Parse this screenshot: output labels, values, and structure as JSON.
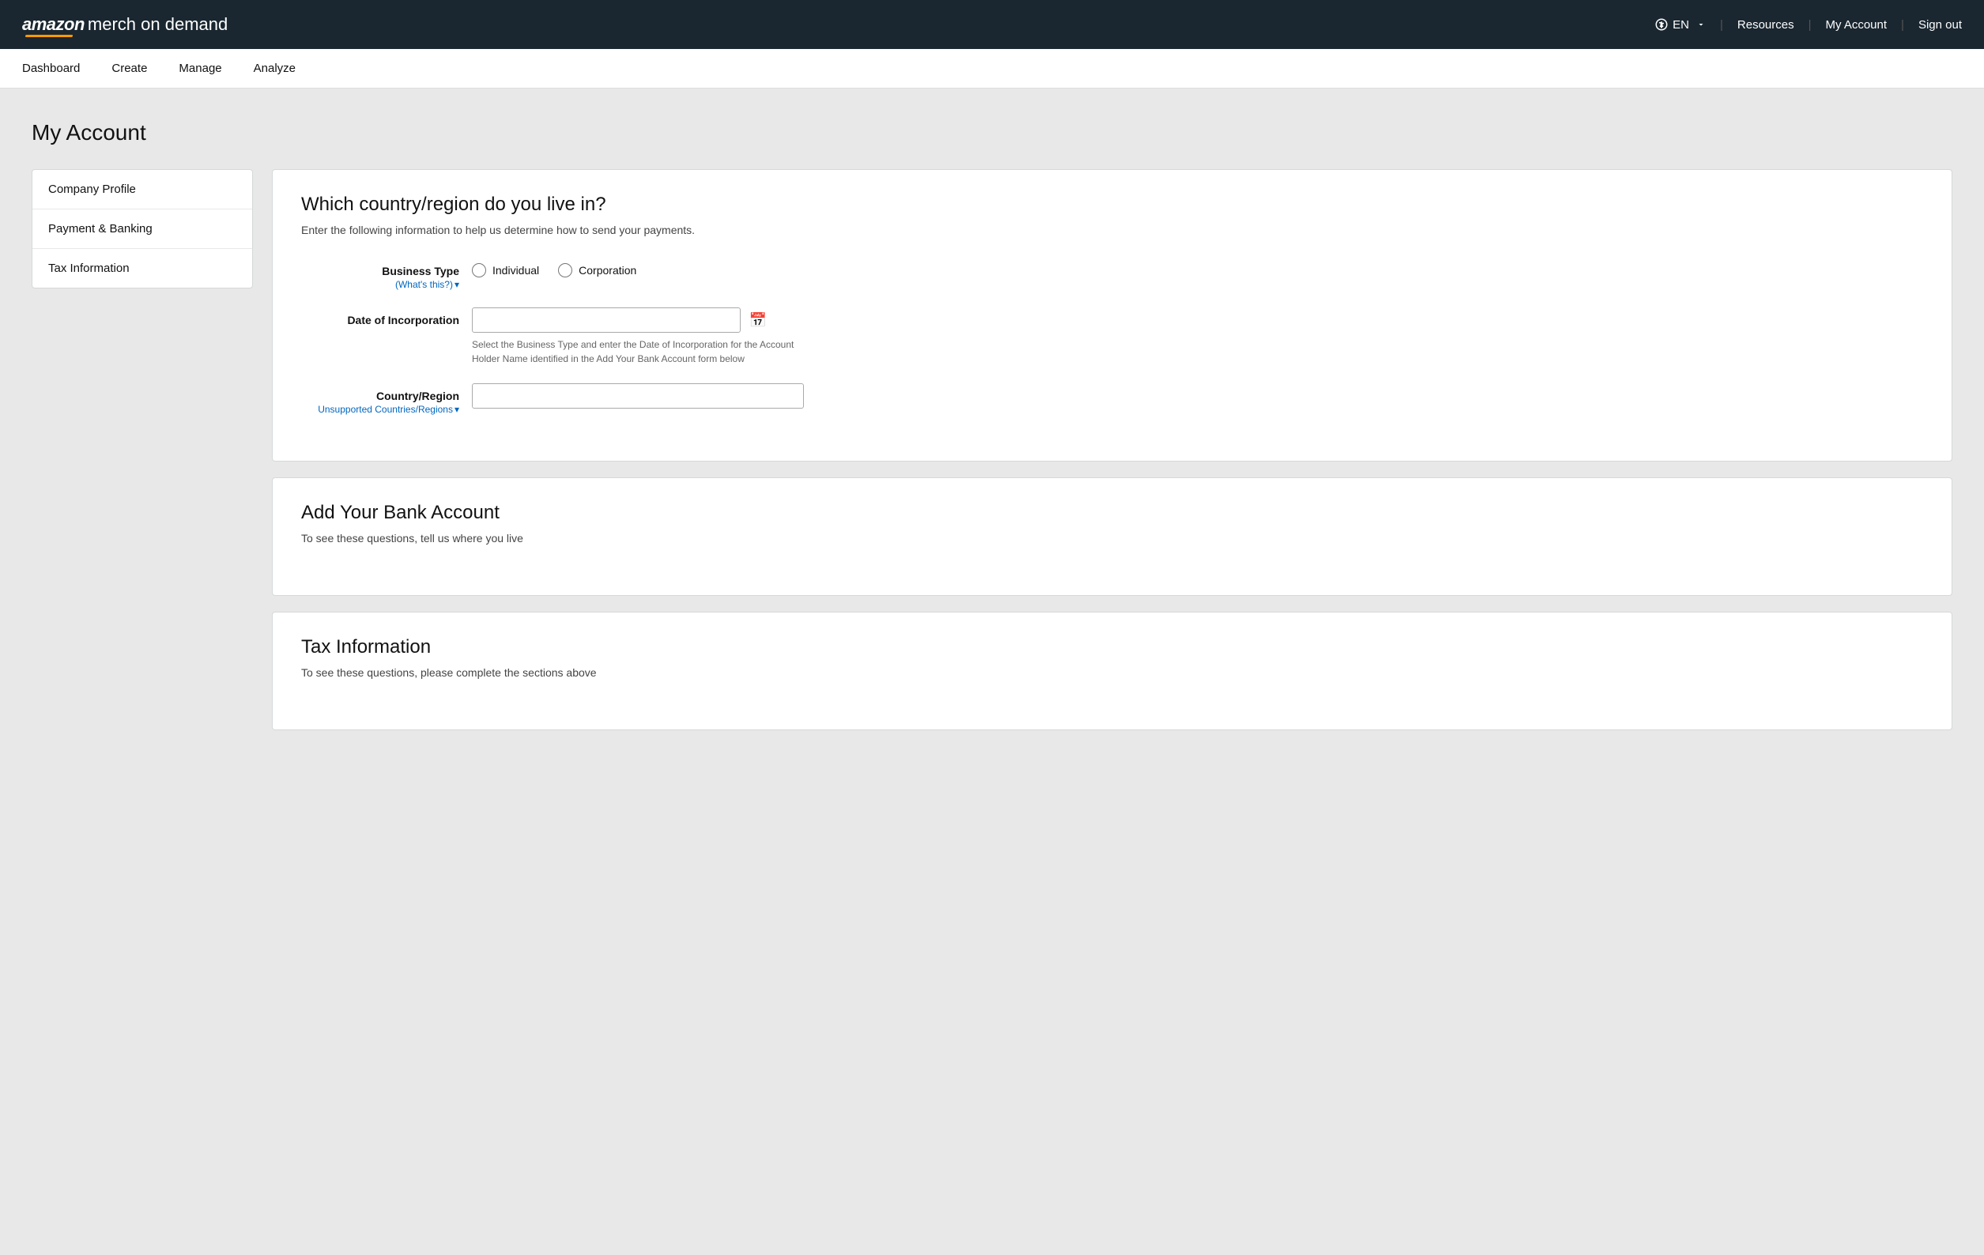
{
  "header": {
    "logo_amazon": "amazon",
    "logo_rest": " merch on demand",
    "lang": "EN",
    "resources_label": "Resources",
    "my_account_label": "My Account",
    "sign_out_label": "Sign out"
  },
  "sub_nav": {
    "items": [
      {
        "label": "Dashboard",
        "id": "dashboard"
      },
      {
        "label": "Create",
        "id": "create"
      },
      {
        "label": "Manage",
        "id": "manage"
      },
      {
        "label": "Analyze",
        "id": "analyze"
      }
    ]
  },
  "page": {
    "title": "My Account"
  },
  "sidebar": {
    "items": [
      {
        "label": "Company Profile",
        "id": "company-profile"
      },
      {
        "label": "Payment & Banking",
        "id": "payment-banking"
      },
      {
        "label": "Tax Information",
        "id": "tax-information"
      }
    ]
  },
  "section_country": {
    "title": "Which country/region do you live in?",
    "subtitle": "Enter the following information to help us determine how to send your payments.",
    "business_type_label": "Business Type",
    "whats_this_label": "(What's this?)",
    "individual_label": "Individual",
    "corporation_label": "Corporation",
    "date_label": "Date of Incorporation",
    "date_hint": "Select the Business Type and enter the Date of Incorporation for the Account Holder Name identified in the Add Your Bank Account form below",
    "country_label": "Country/Region",
    "unsupported_label": "Unsupported Countries/Regions",
    "date_placeholder": "",
    "country_placeholder": ""
  },
  "section_bank": {
    "title": "Add Your Bank Account",
    "subtitle": "To see these questions, tell us where you live"
  },
  "section_tax": {
    "title": "Tax Information",
    "subtitle": "To see these questions, please complete the sections above"
  }
}
